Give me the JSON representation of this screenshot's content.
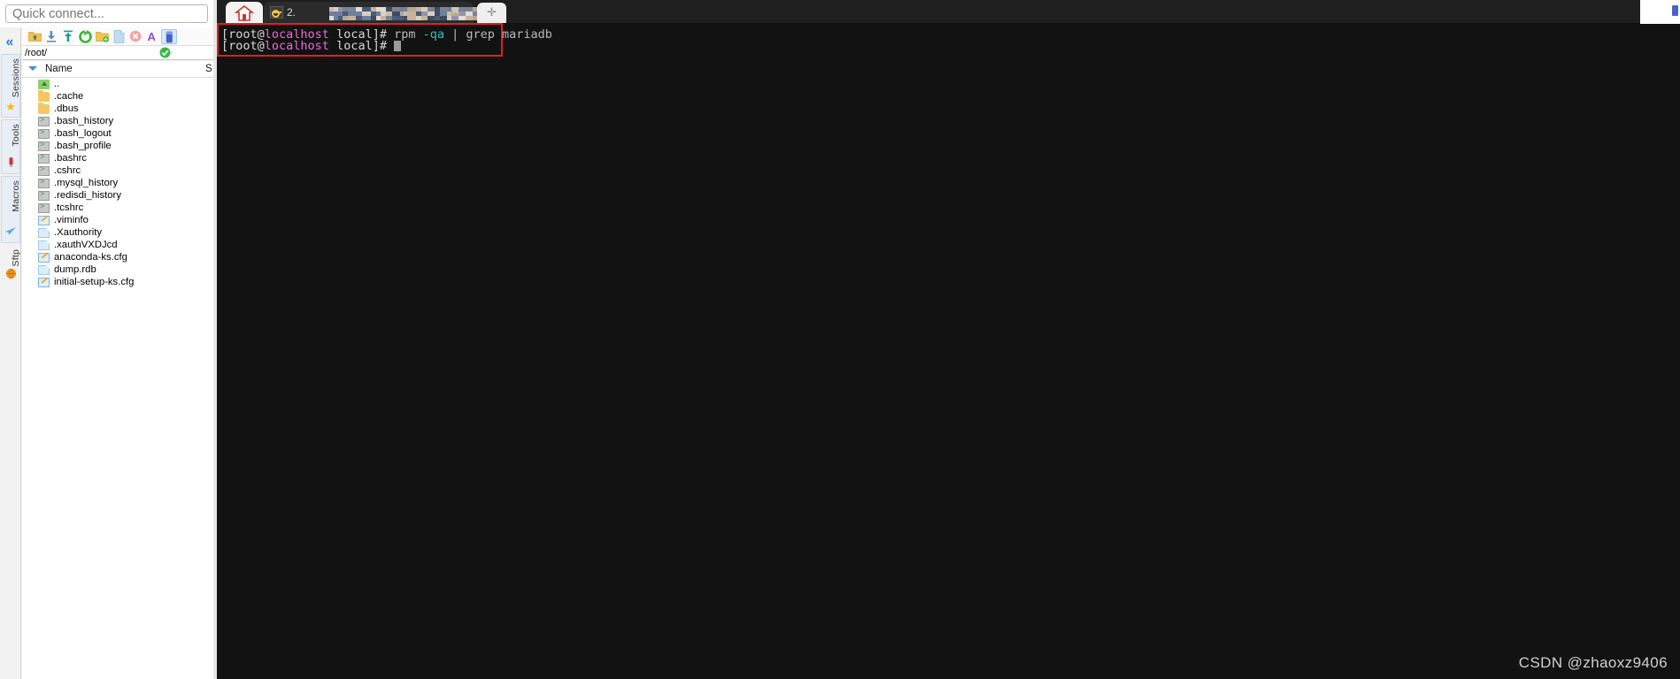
{
  "quick_connect": {
    "placeholder": "Quick connect...",
    "value": ""
  },
  "side_tabs": {
    "collapse_icon": "«",
    "items": [
      {
        "label": "Sessions",
        "icon": "star-icon",
        "glyph": "★",
        "color": "#f5b820"
      },
      {
        "label": "Tools",
        "icon": "swiss-knife-icon",
        "glyph": "🔧",
        "color": "#d63a2f"
      },
      {
        "label": "Macros",
        "icon": "paper-plane-icon",
        "glyph": "➤",
        "color": "#6aa9e0"
      },
      {
        "label": "Sftp",
        "icon": "globe-icon",
        "glyph": "●",
        "color": "#f09a24"
      }
    ]
  },
  "file_browser": {
    "toolbar": [
      {
        "name": "go-up-folder-icon",
        "title": "Up one level"
      },
      {
        "name": "download-icon",
        "title": "Download"
      },
      {
        "name": "upload-icon",
        "title": "Upload"
      },
      {
        "name": "refresh-icon",
        "title": "Refresh"
      },
      {
        "name": "new-folder-icon",
        "title": "New folder"
      },
      {
        "name": "new-file-icon",
        "title": "New file"
      },
      {
        "name": "delete-icon",
        "title": "Delete"
      },
      {
        "name": "rename-icon",
        "title": "Rename"
      },
      {
        "name": "show-hidden-icon",
        "title": "Show hidden files"
      }
    ],
    "path": "/root/",
    "path_ok_icon": "check-icon",
    "columns": {
      "name": "Name",
      "size": "S"
    },
    "files": [
      {
        "name": "..",
        "icon": "up-folder-icon",
        "type": "up"
      },
      {
        "name": ".cache",
        "icon": "folder-icon",
        "type": "folder"
      },
      {
        "name": ".dbus",
        "icon": "folder-icon",
        "type": "folder"
      },
      {
        "name": ".bash_history",
        "icon": "script-file-icon",
        "type": "script"
      },
      {
        "name": ".bash_logout",
        "icon": "script-file-icon",
        "type": "script"
      },
      {
        "name": ".bash_profile",
        "icon": "script-file-icon",
        "type": "script"
      },
      {
        "name": ".bashrc",
        "icon": "script-file-icon",
        "type": "script"
      },
      {
        "name": ".cshrc",
        "icon": "script-file-icon",
        "type": "script"
      },
      {
        "name": ".mysql_history",
        "icon": "script-file-icon",
        "type": "script"
      },
      {
        "name": ".redisdi_history",
        "icon": "script-file-icon",
        "type": "script"
      },
      {
        "name": ".tcshrc",
        "icon": "script-file-icon",
        "type": "script"
      },
      {
        "name": ".viminfo",
        "icon": "edit-file-icon",
        "type": "edit"
      },
      {
        "name": ".Xauthority",
        "icon": "document-icon",
        "type": "doc"
      },
      {
        "name": ".xauthVXDJcd",
        "icon": "document-icon",
        "type": "doc"
      },
      {
        "name": "anaconda-ks.cfg",
        "icon": "edit-file-icon",
        "type": "edit"
      },
      {
        "name": "dump.rdb",
        "icon": "document-icon",
        "type": "doc"
      },
      {
        "name": "initial-setup-ks.cfg",
        "icon": "edit-file-icon",
        "type": "edit"
      }
    ]
  },
  "tabbar": {
    "home_tab": {
      "icon": "home-icon",
      "label": ""
    },
    "session_tab": {
      "icon": "key-icon",
      "label": "2. ",
      "close_icon": "close-icon",
      "redacted": true
    },
    "new_tab": {
      "icon": "plus-icon",
      "glyph": "✛"
    }
  },
  "terminal": {
    "highlight_color": "#e02020",
    "background": "#121212",
    "lines": [
      {
        "segments": [
          {
            "text": "[root@",
            "color": "white"
          },
          {
            "text": "localhost",
            "color": "magenta"
          },
          {
            "text": " local]# ",
            "color": "white"
          },
          {
            "text": "rpm ",
            "color": "gray"
          },
          {
            "text": "-qa",
            "color": "cyan"
          },
          {
            "text": " | ",
            "color": "gray"
          },
          {
            "text": "grep mariadb",
            "color": "gray"
          }
        ]
      },
      {
        "segments": [
          {
            "text": "[root@",
            "color": "white"
          },
          {
            "text": "localhost",
            "color": "magenta"
          },
          {
            "text": " local]# ",
            "color": "white"
          }
        ],
        "cursor": true
      }
    ]
  },
  "watermark": "CSDN @zhaoxz9406"
}
